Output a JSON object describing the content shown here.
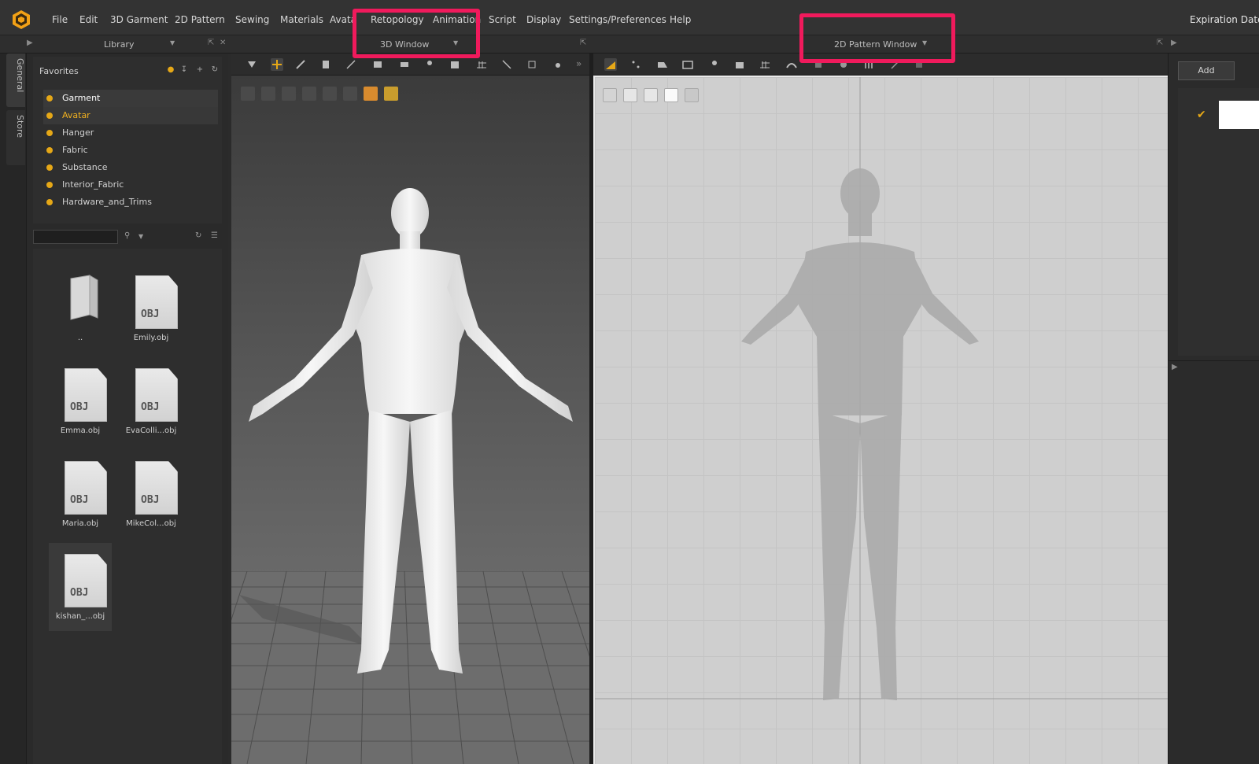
{
  "menu": {
    "items": [
      "File",
      "Edit",
      "3D Garment",
      "2D Pattern",
      "Sewing",
      "Materials",
      "Avata",
      "Retopology",
      "Animation",
      "Script",
      "Display",
      "Settings/Preferences",
      "Help"
    ],
    "expiration": "Expiration Date :"
  },
  "headers": {
    "library": "Library",
    "window3d": "3D Window",
    "window2d": "2D Pattern Window"
  },
  "vertical_tabs": [
    "General",
    "Store"
  ],
  "favorites": {
    "title": "Favorites",
    "items": [
      "Garment",
      "Avatar",
      "Hanger",
      "Fabric",
      "Substance",
      "Interior_Fabric",
      "Hardware_and_Trims"
    ]
  },
  "search": {
    "value": "",
    "placeholder": ""
  },
  "files": [
    {
      "label": "..",
      "type": "folder"
    },
    {
      "label": "Emily.obj",
      "type": "OBJ"
    },
    {
      "label": "Emma.obj",
      "type": "OBJ"
    },
    {
      "label": "EvaColli...obj",
      "type": "OBJ"
    },
    {
      "label": "Maria.obj",
      "type": "OBJ"
    },
    {
      "label": "MikeCol...obj",
      "type": "OBJ"
    },
    {
      "label": "kishan_...obj",
      "type": "OBJ"
    }
  ],
  "right_panel": {
    "add_label": "Add"
  },
  "colors": {
    "accent": "#e6a817",
    "highlight": "#f01a5c"
  }
}
